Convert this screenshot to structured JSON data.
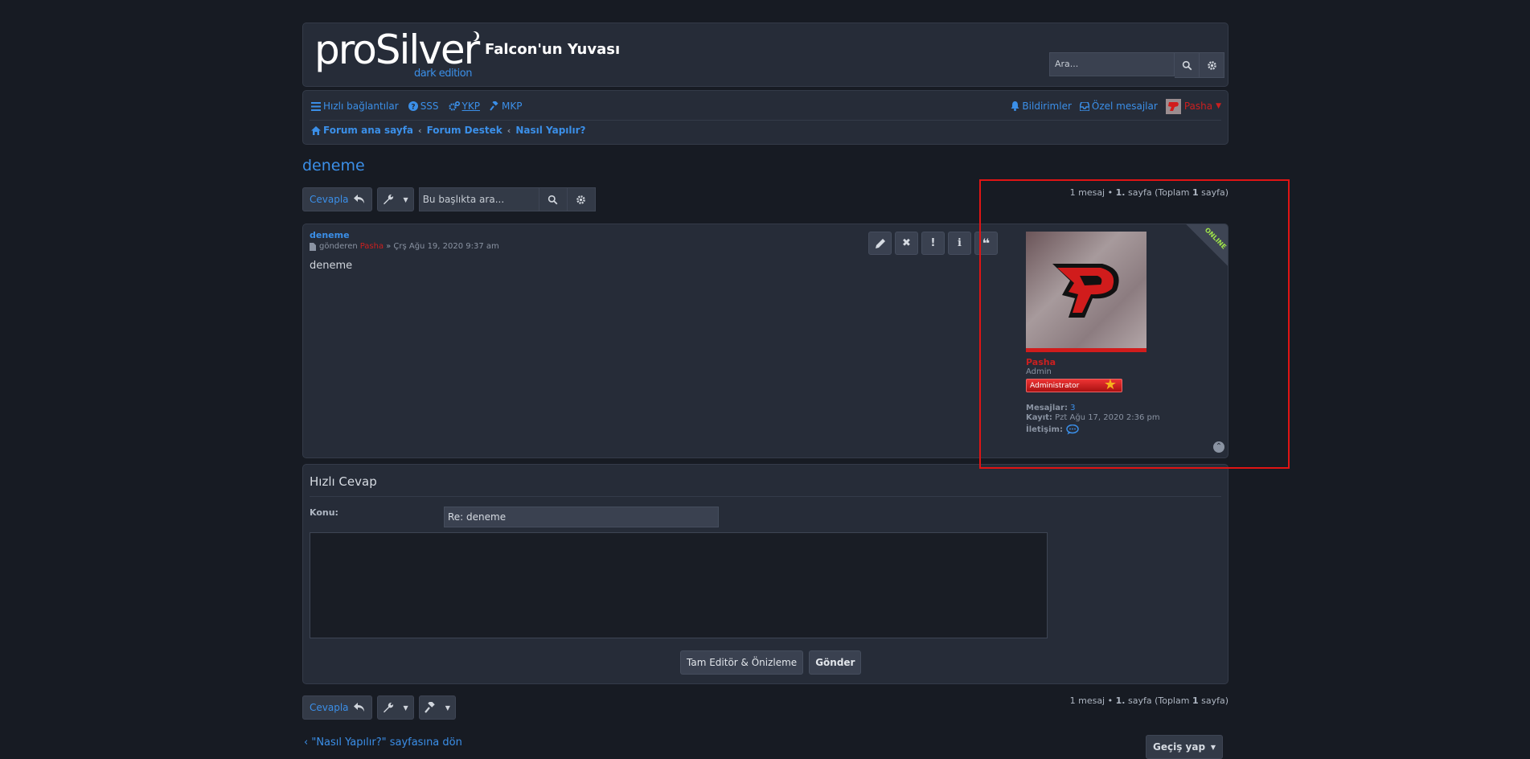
{
  "header": {
    "logo_text": "proSilver",
    "logo_sub": "dark edition",
    "site_title": "Falcon'un Yuvası",
    "search_placeholder": "Ara..."
  },
  "nav": {
    "quick_links": "Hızlı bağlantılar",
    "faq": "SSS",
    "ykp": "YKP",
    "mkp": "MKP",
    "notifications": "Bildirimler",
    "messages": "Özel mesajlar",
    "user": "Pasha"
  },
  "breadcrumbs": [
    "Forum ana sayfa",
    "Forum Destek",
    "Nasıl Yapılır?"
  ],
  "topic": {
    "title": "deneme",
    "reply_label": "Cevapla",
    "search_placeholder": "Bu başlıkta ara...",
    "pagination": {
      "count": "1 mesaj",
      "sep": "•",
      "page_prefix": "1.",
      "page_word": "sayfa",
      "total_open": "(Toplam",
      "total": "1",
      "total_close": "sayfa)"
    }
  },
  "post": {
    "title": "deneme",
    "meta_by": "gönderen",
    "author": "Pasha",
    "meta_date": "» Çrş Ağu 19, 2020 9:37 am",
    "body": "deneme",
    "buttons": [
      "edit",
      "delete",
      "report",
      "info",
      "quote"
    ],
    "online_label": "ONLINE"
  },
  "profile": {
    "name": "Pasha",
    "rank": "Admin",
    "rank_badge": "Administrator",
    "posts_label": "Mesajlar:",
    "posts_value": "3",
    "joined_label": "Kayıt:",
    "joined_value": "Pzt Ağu 17, 2020 2:36 pm",
    "contact_label": "İletişim:"
  },
  "quick_reply": {
    "title": "Hızlı Cevap",
    "subject_label": "Konu:",
    "subject_value": "Re: deneme",
    "editor_button": "Tam Editör & Önizleme",
    "submit_button": "Gönder"
  },
  "footer": {
    "back_link": "\"Nasıl Yapılır?\" sayfasına dön",
    "jump_label": "Geçiş yap"
  },
  "colors": {
    "accent": "#3b8fe8",
    "admin_red": "#cc1f1f",
    "online": "#9fe34a",
    "highlight": "#e01414"
  }
}
